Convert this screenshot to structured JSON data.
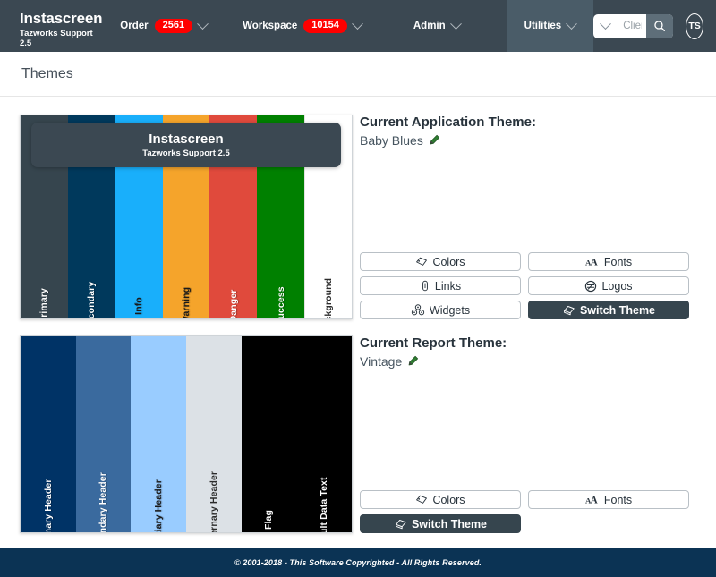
{
  "header": {
    "brand_title": "Instascreen",
    "brand_subtitle": "Tazworks Support 2.5",
    "order_label": "Order",
    "order_value": "2561",
    "workspace_label": "Workspace",
    "workspace_value": "10154",
    "admin_label": "Admin",
    "utilities_label": "Utilities",
    "search_placeholder": "Client Name",
    "search_value": "",
    "avatar_initials": "TS",
    "bg_color": "#3B4852",
    "active_tab_color": "#4A5C68",
    "badge_color": "#FF0000"
  },
  "page": {
    "title": "Themes"
  },
  "app_theme": {
    "preview_banner_title": "Instascreen",
    "preview_banner_subtitle": "Tazworks Support 2.5",
    "heading": "Current Application Theme:",
    "current_name": "Baby Blues",
    "swatches": [
      {
        "label": "Primary",
        "color": "#36454E",
        "text": "#ffffff"
      },
      {
        "label": "Secondary",
        "color": "#00395C",
        "text": "#ffffff"
      },
      {
        "label": "Info",
        "color": "#19AFFB",
        "text": "#1a1a1a"
      },
      {
        "label": "Warning",
        "color": "#F5A42B",
        "text": "#1a1a1a"
      },
      {
        "label": "Danger",
        "color": "#E04A3C",
        "text": "#ffffff"
      },
      {
        "label": "Success",
        "color": "#008000",
        "text": "#ffffff"
      },
      {
        "label": "Background",
        "color": "#FFFFFF",
        "text": "#2b2b2b"
      }
    ],
    "buttons": [
      {
        "label": "Colors",
        "icon": "palette-icon",
        "style": "light"
      },
      {
        "label": "Fonts",
        "icon": "fonts-icon",
        "style": "light"
      },
      {
        "label": "Links",
        "icon": "link-icon",
        "style": "light"
      },
      {
        "label": "Logos",
        "icon": "logo-circle-icon",
        "style": "light"
      },
      {
        "label": "Widgets",
        "icon": "widgets-icon",
        "style": "light"
      },
      {
        "label": "Switch Theme",
        "icon": "layers-icon",
        "style": "dark"
      }
    ]
  },
  "report_theme": {
    "heading": "Current Report Theme:",
    "current_name": "Vintage",
    "swatches": [
      {
        "label": "Primary Header",
        "color": "#003366",
        "text": "#ffffff"
      },
      {
        "label": "Secondary Header",
        "color": "#3A6A9E",
        "text": "#ffffff"
      },
      {
        "label": "Tertiary Header",
        "color": "#99CCFF",
        "text": "#1a1a1a"
      },
      {
        "label": "Quaternary Header",
        "color": "#DCE1E6",
        "text": "#2b2b2b"
      },
      {
        "label": "Flag",
        "color": "#000000",
        "text": "#ffffff"
      },
      {
        "label": "Result Data Text",
        "color": "#000000",
        "text": "#ffffff"
      }
    ],
    "buttons": [
      {
        "label": "Colors",
        "icon": "palette-icon",
        "style": "light"
      },
      {
        "label": "Fonts",
        "icon": "fonts-icon",
        "style": "light"
      },
      {
        "label": "Switch Theme",
        "icon": "layers-icon",
        "style": "dark"
      }
    ]
  },
  "footer": {
    "text": "© 2001-2018 - This Software Copyrighted - All Rights Reserved.",
    "bg_color": "#0B3354"
  }
}
